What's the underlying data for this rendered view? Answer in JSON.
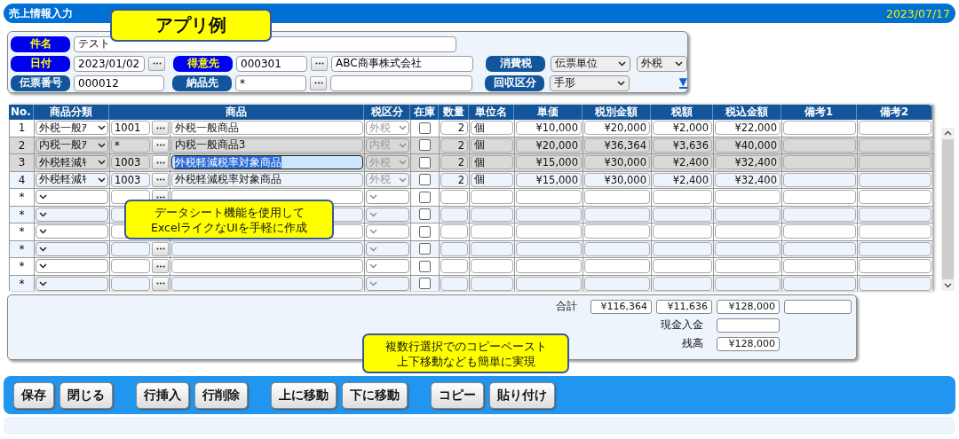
{
  "window": {
    "title": "売上情報入力",
    "date": "2023/07/17"
  },
  "header": {
    "fields": [
      {
        "label": "件名",
        "required": true,
        "value": "テスト"
      },
      {
        "label": "日付",
        "required": true,
        "value": "2023/01/02"
      },
      {
        "label": "得意先",
        "required": true,
        "value": "000301",
        "name": "ABC商事株式会社"
      },
      {
        "label": "伝票番号",
        "required": false,
        "value": "000012"
      },
      {
        "label": "納品先",
        "required": false,
        "value": "*"
      },
      {
        "label": "消費税",
        "required": false,
        "select": "伝票単位",
        "select2": "外税"
      },
      {
        "label": "回収区分",
        "required": false,
        "select": "手形"
      }
    ],
    "expand": "▼"
  },
  "table": {
    "columns": [
      "No.",
      "商品分類",
      "商品",
      "税区分",
      "在庫",
      "数量",
      "単位名",
      "単価",
      "税別金額",
      "税額",
      "税込金額",
      "備考1",
      "備考2"
    ],
    "rows": [
      {
        "no": "1",
        "selected": false,
        "focused": false,
        "category": "外税一般ｱ",
        "code": "1001",
        "product": "外税一般商品",
        "tax": "外税",
        "stock": false,
        "qty": "2",
        "unit": "個",
        "price": "¥10,000",
        "excl": "¥20,000",
        "tax_amount": "¥2,000",
        "incl": "¥22,000"
      },
      {
        "no": "2",
        "selected": true,
        "focused": false,
        "category": "内税一般ｱ",
        "code": "*",
        "product": "内税一般商品3",
        "tax": "内税",
        "stock": false,
        "qty": "2",
        "unit": "個",
        "price": "¥20,000",
        "excl": "¥36,364",
        "tax_amount": "¥3,636",
        "incl": "¥40,000"
      },
      {
        "no": "3",
        "selected": true,
        "focused": true,
        "category": "外税軽減ｷ",
        "code": "1003",
        "product": "外税軽減税率対象商品",
        "tax": "外税",
        "stock": false,
        "qty": "2",
        "unit": "個",
        "price": "¥15,000",
        "excl": "¥30,000",
        "tax_amount": "¥2,400",
        "incl": "¥32,400"
      },
      {
        "no": "4",
        "selected": false,
        "focused": false,
        "category": "外税軽減ｷ",
        "code": "1003",
        "product": "外税軽減税率対象商品",
        "tax": "外税",
        "stock": false,
        "qty": "2",
        "unit": "個",
        "price": "¥15,000",
        "excl": "¥30,000",
        "tax_amount": "¥2,400",
        "incl": "¥32,400"
      },
      {
        "no": "*",
        "selected": false,
        "focused": false,
        "stock": false
      },
      {
        "no": "*",
        "selected": false,
        "focused": false,
        "stock": false
      },
      {
        "no": "*",
        "selected": false,
        "focused": false,
        "stock": false
      },
      {
        "no": "*",
        "selected": false,
        "focused": false,
        "stock": false
      },
      {
        "no": "*",
        "selected": false,
        "focused": false,
        "stock": false
      },
      {
        "no": "*",
        "selected": false,
        "focused": false,
        "stock": false
      }
    ]
  },
  "totals": {
    "label": "合計",
    "excl": "¥116,364",
    "tax_amount": "¥11,636",
    "incl": "¥128,000",
    "cash_label": "現金入金",
    "balance_label": "残高",
    "balance": "¥128,000"
  },
  "button_groups": [
    [
      "保存",
      "閉じる"
    ],
    [
      "行挿入",
      "行削除"
    ],
    [
      "上に移動",
      "下に移動"
    ],
    [
      "コピー",
      "貼り付け"
    ]
  ],
  "callouts": [
    {
      "kind": "title",
      "lines": [
        "アプリ例"
      ]
    },
    {
      "kind": "note",
      "lines": [
        "データシート機能を使用して",
        "ExcelライクなUIを手軽に作成"
      ]
    },
    {
      "kind": "note",
      "lines": [
        "複数行選択でのコピーペースト",
        "上下移動なども簡単に実現"
      ]
    }
  ]
}
